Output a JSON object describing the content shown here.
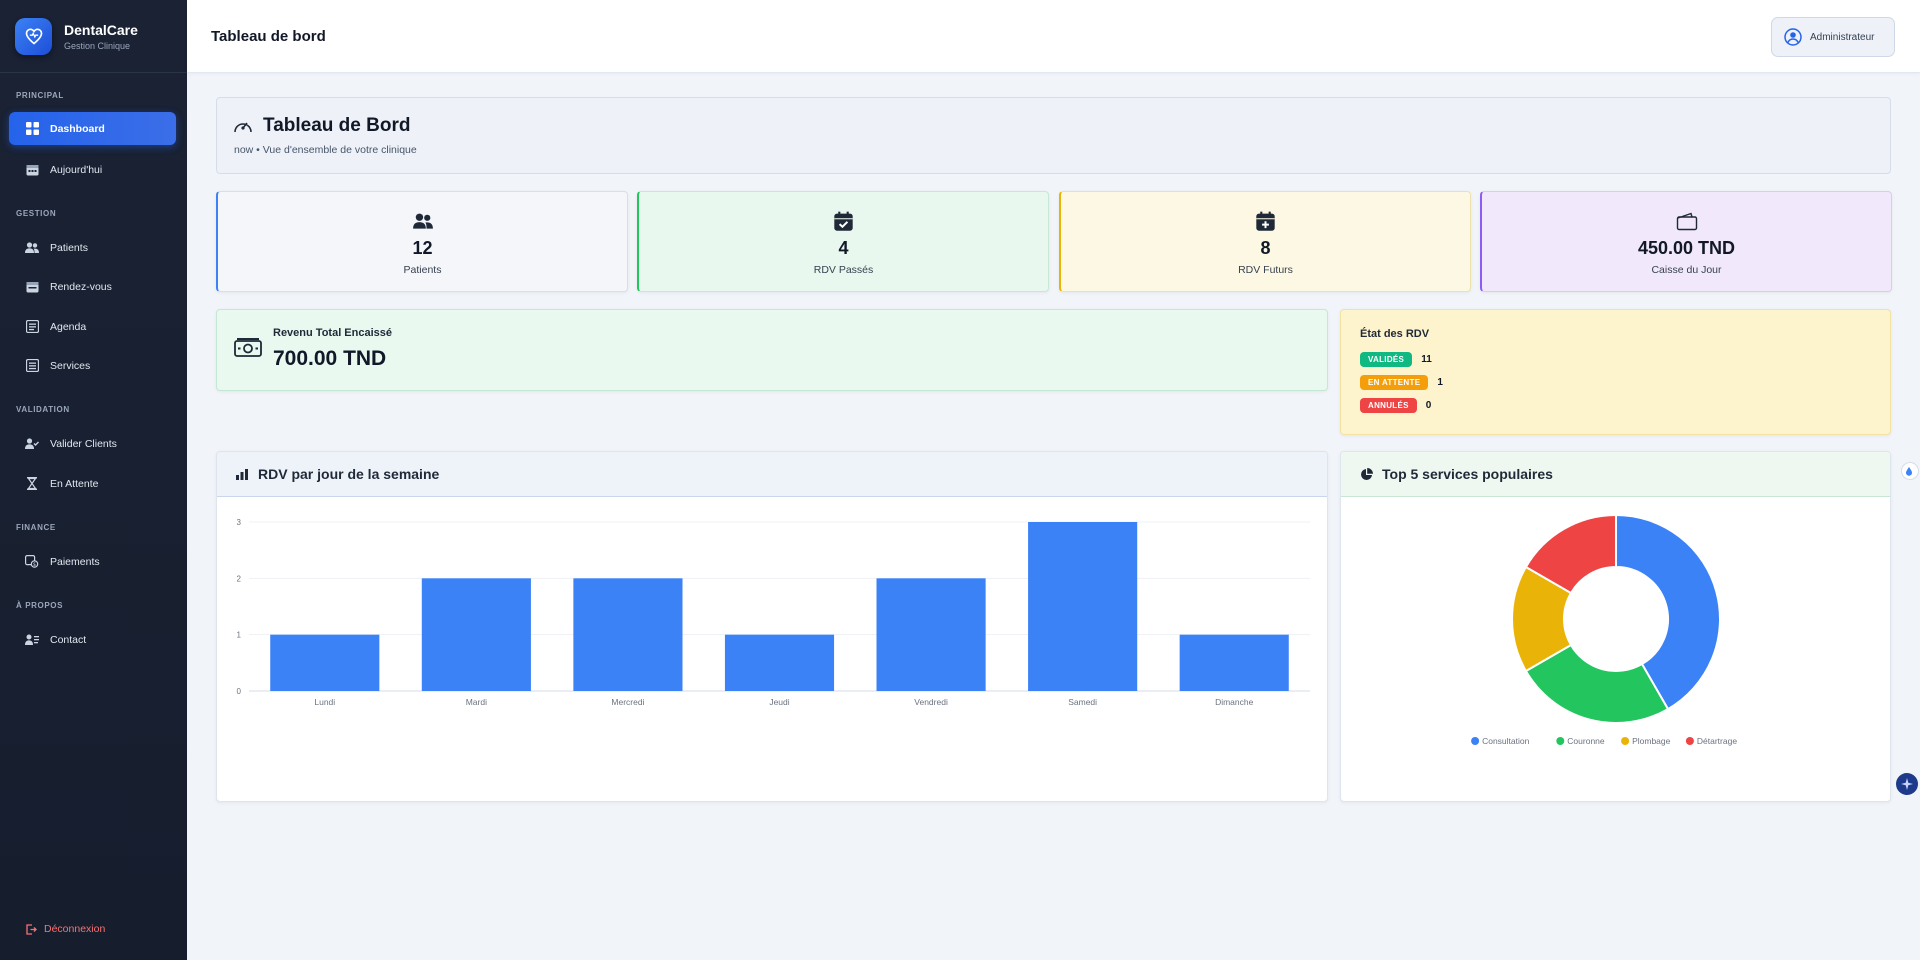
{
  "brand": {
    "name": "DentalCare",
    "subtitle": "Gestion Clinique"
  },
  "sidebar": {
    "sections": [
      {
        "label": "PRINCIPAL"
      },
      {
        "label": "GESTION"
      },
      {
        "label": "VALIDATION"
      },
      {
        "label": "FINANCE"
      },
      {
        "label": "À PROPOS"
      }
    ],
    "items": [
      {
        "label": "Dashboard",
        "icon": "grid-icon",
        "active": true
      },
      {
        "label": "Aujourd'hui",
        "icon": "calendar-icon"
      },
      {
        "label": "Patients",
        "icon": "users-icon"
      },
      {
        "label": "Rendez-vous",
        "icon": "calendar-icon"
      },
      {
        "label": "Agenda",
        "icon": "list-icon"
      },
      {
        "label": "Services",
        "icon": "list-icon"
      },
      {
        "label": "Valider Clients",
        "icon": "user-check-icon"
      },
      {
        "label": "En Attente",
        "icon": "hourglass-icon"
      },
      {
        "label": "Paiements",
        "icon": "money-icon"
      },
      {
        "label": "Contact",
        "icon": "contact-icon"
      }
    ],
    "logout": "Déconnexion"
  },
  "topbar": {
    "title": "Tableau de bord",
    "user": "Administrateur"
  },
  "header": {
    "title": "Tableau de Bord",
    "subtitle": "now • Vue d'ensemble de votre clinique"
  },
  "stats": [
    {
      "value": "12",
      "label": "Patients",
      "icon": "users-icon"
    },
    {
      "value": "4",
      "label": "RDV Passés",
      "icon": "calendar-check-icon"
    },
    {
      "value": "8",
      "label": "RDV Futurs",
      "icon": "calendar-plus-icon"
    },
    {
      "value": "450.00 TND",
      "label": "Caisse du Jour",
      "icon": "wallet-icon"
    }
  ],
  "revenue": {
    "label": "Revenu Total Encaissé",
    "value": "700.00 TND"
  },
  "rdv_status": {
    "title": "État des RDV",
    "rows": [
      {
        "badge": "VALIDÉS",
        "count": "11",
        "color": "#10b981"
      },
      {
        "badge": "EN ATTENTE",
        "count": "1",
        "color": "#f59e0b"
      },
      {
        "badge": "ANNULÉS",
        "count": "0",
        "color": "#ef4444"
      }
    ]
  },
  "bar_panel": {
    "title": "RDV par jour de la semaine"
  },
  "pie_panel": {
    "title": "Top 5 services populaires"
  },
  "colors": {
    "accent": "#3b82f6",
    "sidebar": "#1a2234",
    "green": "#22c55e",
    "yellow": "#eab308",
    "red": "#ef4444"
  },
  "chart_data": [
    {
      "type": "bar",
      "categories": [
        "Lundi",
        "Mardi",
        "Mercredi",
        "Jeudi",
        "Vendredi",
        "Samedi",
        "Dimanche"
      ],
      "values": [
        1,
        2,
        2,
        1,
        2,
        3,
        1
      ],
      "ylim": [
        0,
        3
      ],
      "yticks": [
        0,
        1,
        2,
        3
      ],
      "color": "#3b82f6",
      "grid": true
    },
    {
      "type": "pie",
      "categories": [
        "Consultation",
        "Couronne",
        "Plombage",
        "Détartrage"
      ],
      "values": [
        5,
        3,
        2,
        2
      ],
      "colors": [
        "#3b82f6",
        "#22c55e",
        "#eab308",
        "#ef4444"
      ],
      "legend": "bottom"
    }
  ]
}
